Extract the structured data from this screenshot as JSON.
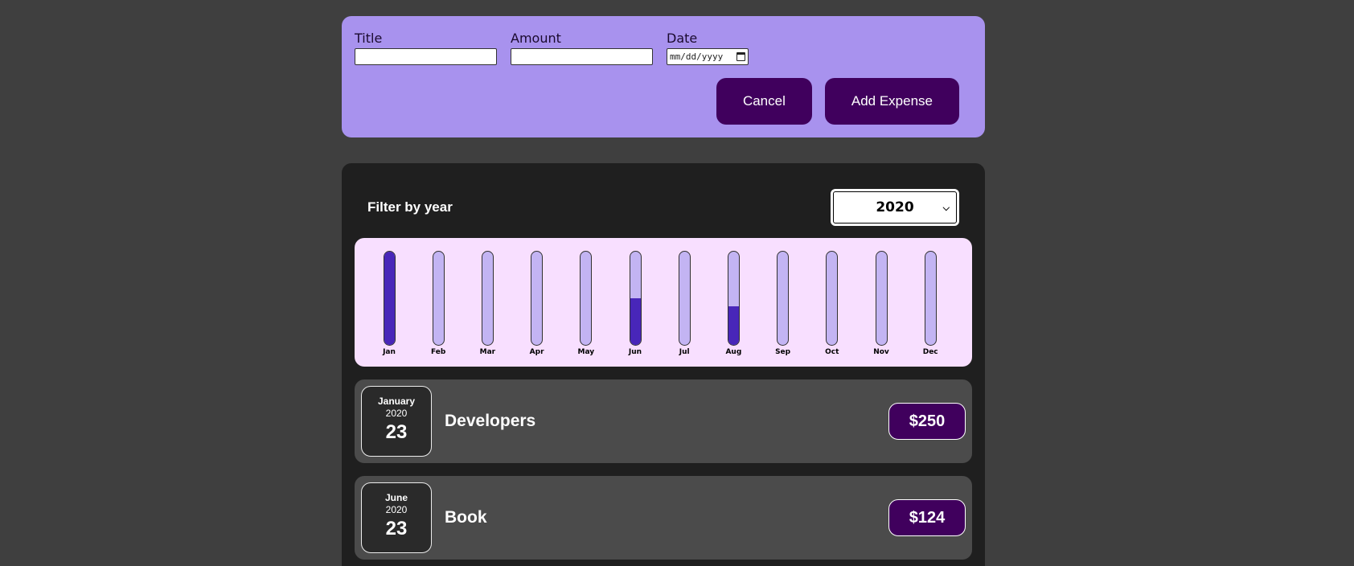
{
  "form": {
    "title_label": "Title",
    "title_value": "",
    "amount_label": "Amount",
    "amount_value": "",
    "date_label": "Date",
    "date_placeholder": "mm/dd/yyyy",
    "cancel_label": "Cancel",
    "submit_label": "Add Expense"
  },
  "filter": {
    "label": "Filter by year",
    "selected_year": "2020"
  },
  "chart_data": {
    "type": "bar",
    "categories": [
      "Jan",
      "Feb",
      "Mar",
      "Apr",
      "May",
      "Jun",
      "Jul",
      "Aug",
      "Sep",
      "Oct",
      "Nov",
      "Dec"
    ],
    "values": [
      250,
      0,
      0,
      0,
      0,
      124,
      0,
      103,
      0,
      0,
      0,
      0
    ],
    "ylim": [
      0,
      250
    ],
    "colors": {
      "fill": "#4826b9",
      "track": "#c3b4f3",
      "background": "#f8dfff"
    }
  },
  "expenses": [
    {
      "month": "January",
      "year": "2020",
      "day": "23",
      "title": "Developers",
      "amount": "$250"
    },
    {
      "month": "June",
      "year": "2020",
      "day": "23",
      "title": "Book",
      "amount": "$124"
    }
  ],
  "colors": {
    "page_bg": "#3f3f3f",
    "form_bg": "#a892ee",
    "button_bg": "#40005d",
    "panel_bg": "#1f1f1f",
    "item_bg": "#4b4b4b"
  }
}
